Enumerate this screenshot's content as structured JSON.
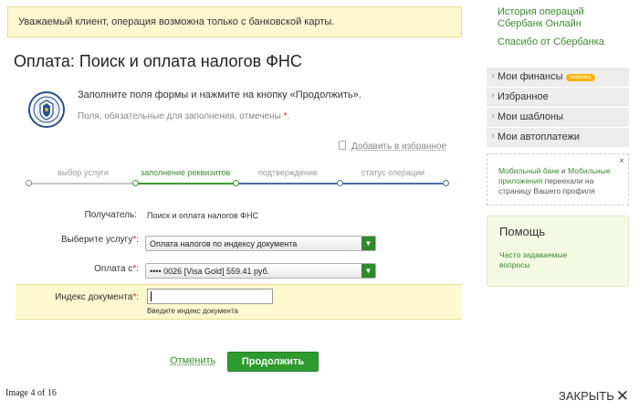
{
  "notice": "Уважаемый клиент, операция возможна только с банковской карты.",
  "page_title": "Оплата: Поиск и оплата налогов ФНС",
  "instructions": {
    "line1": "Заполните поля формы и нажмите на кнопку «Продолжить».",
    "line2": "Поля, обязательные для заполнения, отмечены",
    "required_mark": "*",
    "line2_end": "."
  },
  "favorites_link": "Добавить в избранное",
  "steps": [
    {
      "label": "выбор услуги",
      "state": "done"
    },
    {
      "label": "заполнение реквизитов",
      "state": "active"
    },
    {
      "label": "подтверждение",
      "state": "pending"
    },
    {
      "label": "статус операции",
      "state": "pending"
    }
  ],
  "form": {
    "recipient": {
      "label": "Получатель:",
      "value": "Поиск и оплата налогов ФНС"
    },
    "service": {
      "label": "Выберите услугу",
      "required_mark": "*",
      "colon": ":",
      "value": "Оплата налогов по индексу документа"
    },
    "pay_from": {
      "label": "Оплата с",
      "required_mark": "*",
      "colon": ":",
      "value": "•••• 0026 [Visa Gold] 559.41 руб."
    },
    "doc_index": {
      "label": "Индекс документа",
      "required_mark": "*",
      "colon": ":",
      "value": "",
      "hint": "Введите индекс документа"
    }
  },
  "actions": {
    "cancel": "Отменить",
    "continue": "Продолжить"
  },
  "sidebar": {
    "history_link": "История операций Сбербанк Онлайн",
    "thanks_link": "Спасибо от Сбербанка",
    "menu": [
      {
        "label": "Мои финансы",
        "badge": "новинка"
      },
      {
        "label": "Избранное",
        "badge": ""
      },
      {
        "label": "Мои шаблоны",
        "badge": ""
      },
      {
        "label": "Мои автоплатежи",
        "badge": ""
      }
    ],
    "mobile_notice": {
      "part1": "Мобильный банк",
      "part2": " и ",
      "part3": "Мобильные приложения",
      "part4": " переехали на страницу Вашего профиля",
      "close": "×"
    },
    "help": {
      "title": "Помощь",
      "faq_link": "Часто задаваемые вопросы"
    }
  },
  "viewer": {
    "counter": "Image 4 of 16",
    "close": "ЗАКРЫТЬ",
    "close_icon": "✕"
  },
  "colors": {
    "accent_green": "#2e9b2e",
    "link_green": "#3a8a2e",
    "notice_bg": "#fcf8d0",
    "step_blue": "#4a6fa5",
    "badge_orange": "#f7b500"
  }
}
